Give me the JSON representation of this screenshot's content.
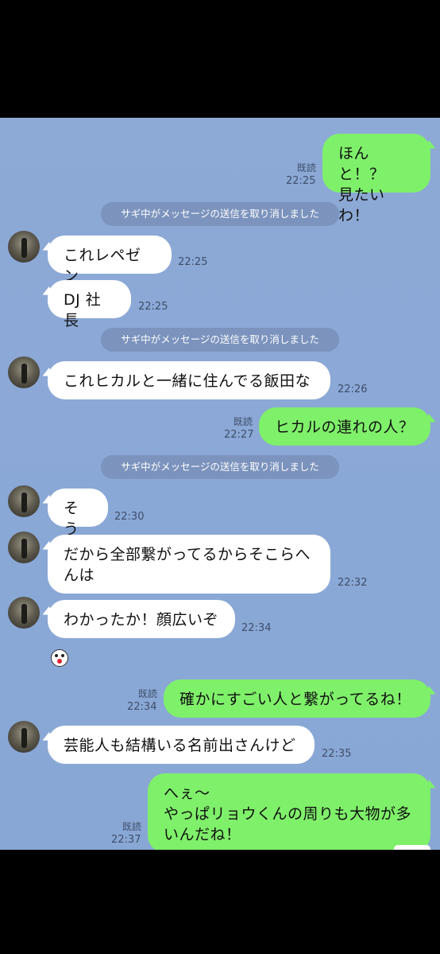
{
  "messages": {
    "m1": {
      "text_line1": "ほんと！？",
      "text_line2": "見たいわ！",
      "read": "既読",
      "time": "22:25"
    },
    "sys1": "サギ中がメッセージの送信を取り消しました",
    "m2": {
      "text": "これレペゼン",
      "time": "22:25"
    },
    "m3": {
      "text": "DJ 社長",
      "time": "22:25"
    },
    "sys2": "サギ中がメッセージの送信を取り消しました",
    "m4": {
      "text": "これヒカルと一緒に住んでる飯田な",
      "time": "22:26"
    },
    "m5": {
      "text": "ヒカルの連れの人？",
      "read": "既読",
      "time": "22:27"
    },
    "sys3": "サギ中がメッセージの送信を取り消しました",
    "m6": {
      "text": "そう",
      "time": "22:30"
    },
    "m7": {
      "text_line1": "だから全部繋がってるからそこらへ",
      "text_line2": "んは",
      "time": "22:32"
    },
    "m8": {
      "text": "わかったか！顔広いぞ",
      "time": "22:34"
    },
    "m9": {
      "text": "確かにすごい人と繋がってるね！",
      "read": "既読",
      "time": "22:34"
    },
    "m10": {
      "text": "芸能人も結構いる名前出さんけど",
      "time": "22:35"
    },
    "m11": {
      "text_line1": "へぇ〜",
      "text_line2": "やっぱリョウくんの周りも大物が多",
      "text_line3": "いんだね！",
      "read": "既読",
      "time": "22:37"
    }
  },
  "colors": {
    "chat_bg": "#8aa8d6",
    "outgoing": "#7ff06a",
    "incoming": "#ffffff",
    "system": "#7b93bd"
  },
  "icons": {
    "sticker": "face-sticker-icon"
  }
}
